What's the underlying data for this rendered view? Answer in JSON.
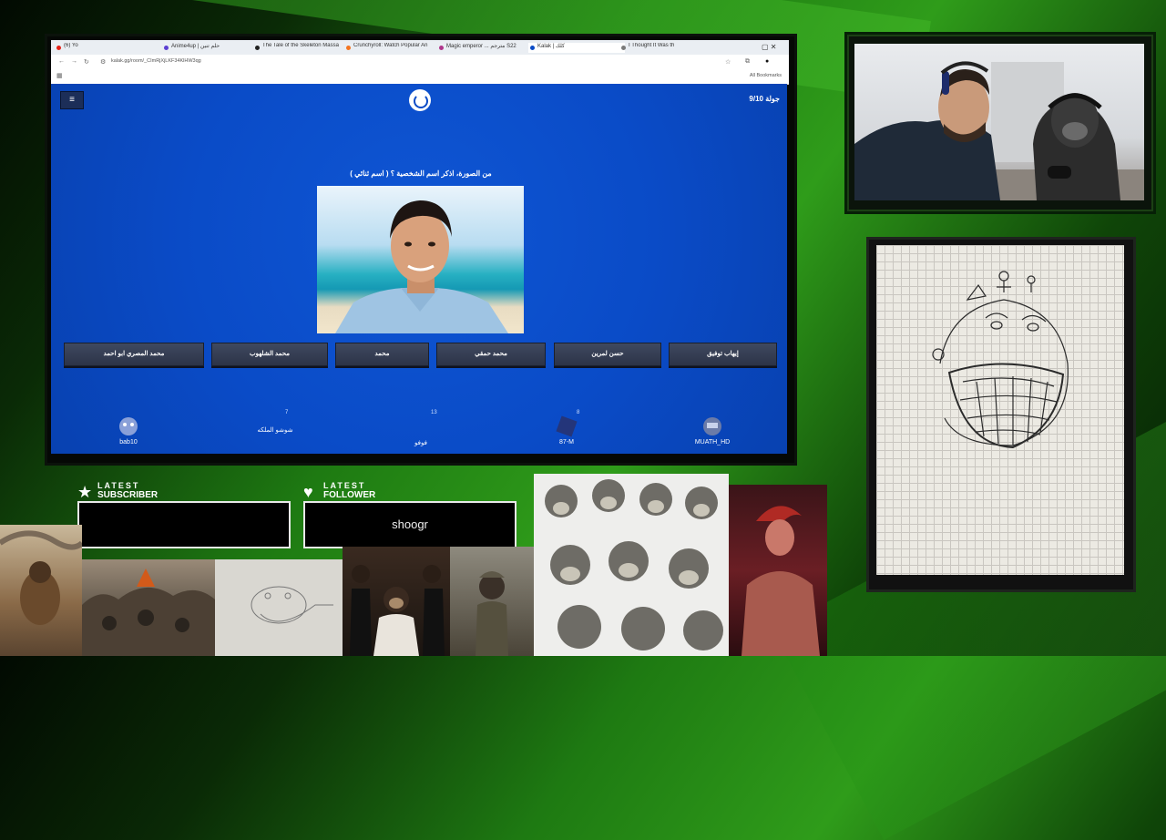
{
  "browser": {
    "tabs": [
      {
        "title": "(6) Yo",
        "color": "#e62117"
      },
      {
        "title": "Anime4up | حلم تنين",
        "color": "#5b3fd1"
      },
      {
        "title": "The Tale of the Skeleton Massa",
        "color": "#222222"
      },
      {
        "title": "Crunchyroll: Watch Popular An",
        "color": "#f47521"
      },
      {
        "title": "Magic emperor ... مترجم S22",
        "color": "#b0368c"
      },
      {
        "title": "Kalak | كلك",
        "color": "#0b4bc6"
      },
      {
        "title": "I Thought It Was th",
        "color": "#7a7a7a"
      }
    ],
    "url": "kalak.gg/room/_CImRjXjLKF34KlHW3qg",
    "bookmarks_label": "All Bookmarks"
  },
  "game": {
    "round_label": "جولة 9/10",
    "question": "من الصورة، اذكر اسم الشخصية ؟ ( اسم ثنائي )",
    "answers": [
      "محمد المصري ابو احمد",
      "محمد الشلهوب",
      "محمد",
      "محمد حمقي",
      "حسن لمرين",
      "إيهاب توفيق"
    ],
    "players": [
      {
        "name": "bab10",
        "points": ""
      },
      {
        "name": "شوشو الملكه",
        "points": "7"
      },
      {
        "name": "فوفو",
        "points": "13"
      },
      {
        "name": "87-M",
        "points": "8"
      },
      {
        "name": "MUATH_HD",
        "points": ""
      }
    ]
  },
  "overlay": {
    "latest_subscriber": {
      "line1": "LATEST",
      "line2": "SUBSCRIBER",
      "value": ""
    },
    "latest_follower": {
      "line1": "LATEST",
      "line2": "FOLLOWER",
      "value": "shoogr"
    }
  },
  "colors": {
    "accent_green": "#2f9c1a",
    "game_blue": "#0b4bc6",
    "answer_button": "#353d52"
  },
  "icons": [
    "hamburger-menu-icon",
    "kalak-logo-icon",
    "star-icon",
    "heart-icon",
    "back-arrow-icon",
    "forward-arrow-icon",
    "reload-icon",
    "bookmark-star-icon",
    "extensions-icon"
  ]
}
